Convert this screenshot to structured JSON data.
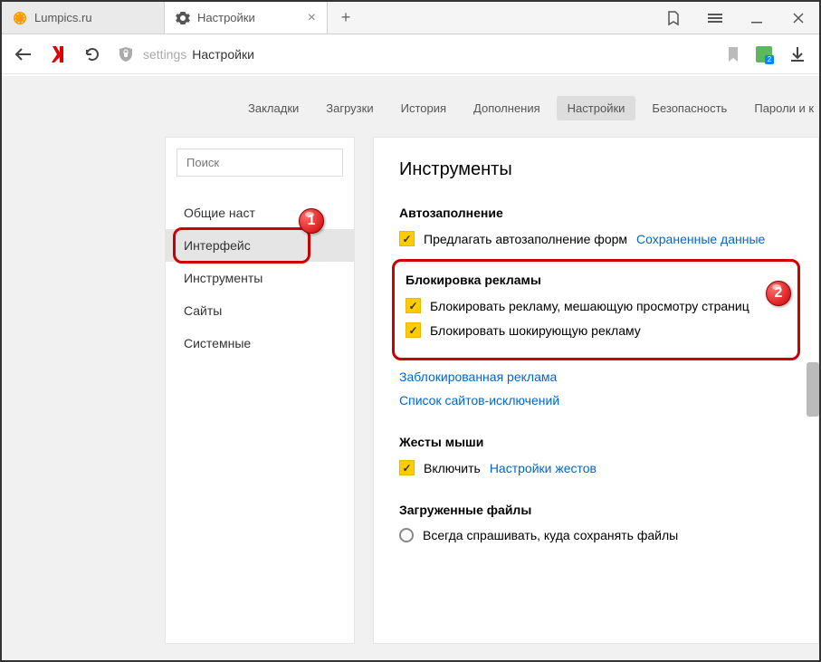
{
  "tabs": [
    {
      "title": "Lumpics.ru",
      "favicon_color": "#f90"
    },
    {
      "title": "Настройки",
      "favicon": "gear"
    }
  ],
  "toolbar": {
    "addr_prefix": "settings",
    "addr_title": "Настройки"
  },
  "navtabs": [
    "Закладки",
    "Загрузки",
    "История",
    "Дополнения",
    "Настройки",
    "Безопасность",
    "Пароли и к"
  ],
  "navtabs_active_index": 4,
  "sidebar": {
    "search_placeholder": "Поиск",
    "items": [
      "Общие наст",
      "Интерфейс",
      "Инструменты",
      "Сайты",
      "Системные"
    ],
    "active_index": 1
  },
  "main": {
    "heading": "Инструменты",
    "autofill": {
      "title": "Автозаполнение",
      "opt1": "Предлагать автозаполнение форм",
      "link1": "Сохраненные данные"
    },
    "adblock": {
      "title": "Блокировка рекламы",
      "opt1": "Блокировать рекламу, мешающую просмотру страниц",
      "opt2": "Блокировать шокирующую рекламу",
      "link1": "Заблокированная реклама",
      "link2": "Список сайтов-исключений"
    },
    "mouse": {
      "title": "Жесты мыши",
      "opt1": "Включить",
      "link1": "Настройки жестов"
    },
    "downloads": {
      "title": "Загруженные файлы",
      "opt1": "Всегда спрашивать, куда сохранять файлы"
    }
  },
  "badges": {
    "b1": "1",
    "b2": "2"
  }
}
